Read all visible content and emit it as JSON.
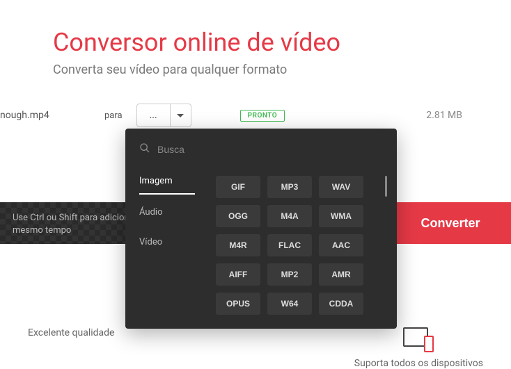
{
  "header": {
    "title": "Conversor online de vídeo",
    "subtitle": "Converta seu vídeo para qualquer formato"
  },
  "file_row": {
    "filename": "nough.mp4",
    "para_label": "para",
    "selected_format": "...",
    "status": "PRONTO",
    "file_size": "2.81 MB"
  },
  "action": {
    "instruction_line1": "Use Ctrl ou Shift para adicionar",
    "instruction_line2": "mesmo tempo",
    "convert_label": "Converter"
  },
  "dropdown": {
    "search_placeholder": "Busca",
    "categories": [
      {
        "label": "Imagem",
        "active": true
      },
      {
        "label": "Áudio",
        "active": false
      },
      {
        "label": "Vídeo",
        "active": false
      }
    ],
    "formats": [
      "GIF",
      "MP3",
      "WAV",
      "OGG",
      "M4A",
      "WMA",
      "M4R",
      "FLAC",
      "AAC",
      "AIFF",
      "MP2",
      "AMR",
      "OPUS",
      "W64",
      "CDDA"
    ]
  },
  "features": {
    "quality_label": "Excelente qualidade",
    "devices_label": "Suporta todos os dispositivos"
  }
}
